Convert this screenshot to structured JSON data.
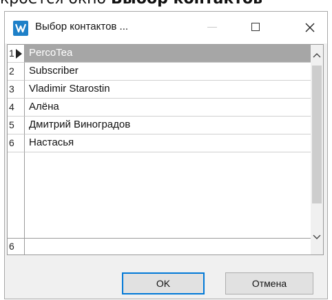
{
  "page": {
    "caption_prefix": "кроется окно",
    "caption_bold": "Выбор контактов"
  },
  "window": {
    "title": "Выбор контактов ...",
    "icons": {
      "app": "app-logo-icon",
      "minimize": "minimize-icon",
      "maximize": "maximize-icon",
      "close": "close-icon"
    }
  },
  "grid": {
    "rows": [
      {
        "index": "1",
        "name": "PercoTea",
        "selected": true
      },
      {
        "index": "2",
        "name": "Subscriber"
      },
      {
        "index": "3",
        "name": "Vladimir Starostin"
      },
      {
        "index": "4",
        "name": "Алёна"
      },
      {
        "index": "5",
        "name": "Дмитрий Виноградов"
      },
      {
        "index": "6",
        "name": "Настасья"
      }
    ],
    "footer_count": "6",
    "icons": {
      "row_pointer": "row-pointer-icon",
      "scroll_up": "chevron-up-icon",
      "scroll_down": "chevron-down-icon"
    }
  },
  "buttons": {
    "ok": "OK",
    "cancel": "Отмена"
  }
}
